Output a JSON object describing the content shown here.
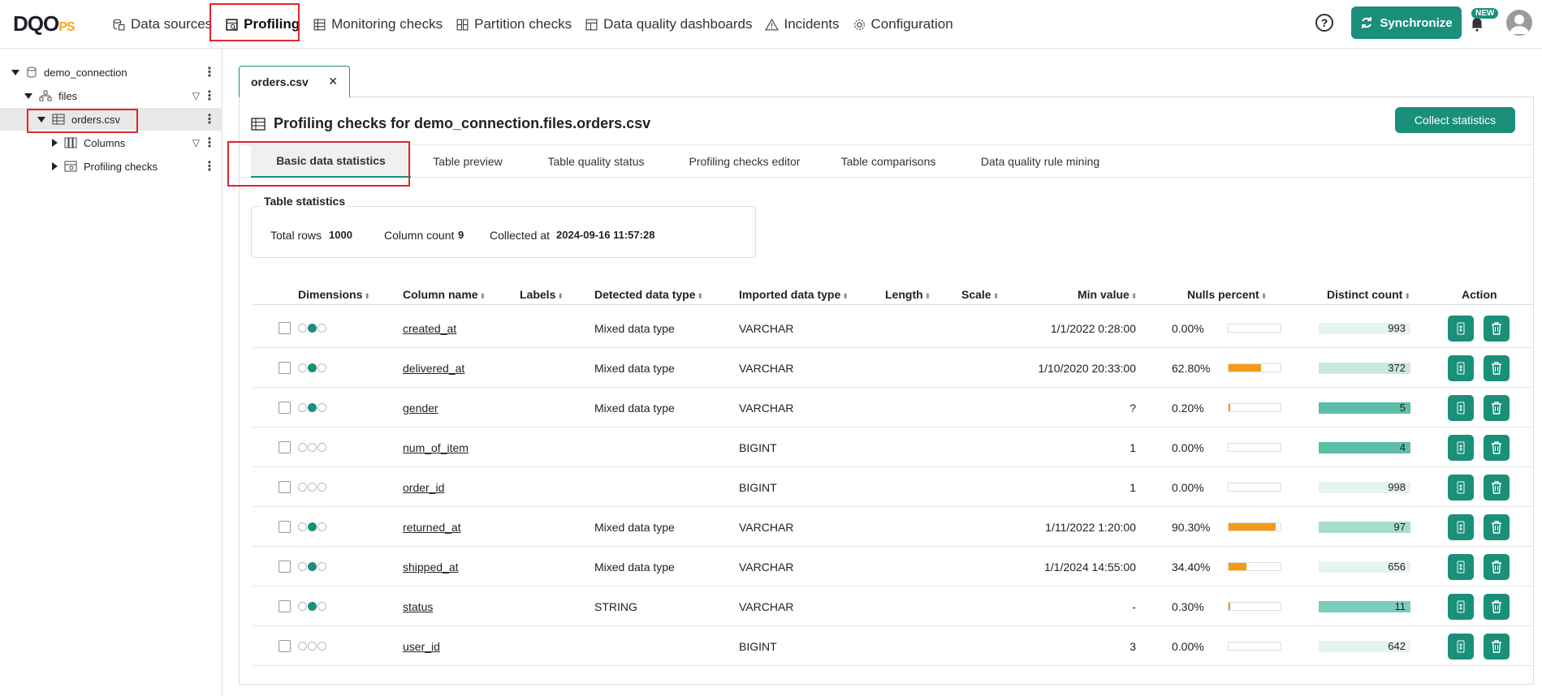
{
  "app": {
    "logo": "DQO",
    "logo_suffix": "PS"
  },
  "nav": [
    {
      "label": "Data sources",
      "icon": "database-icon"
    },
    {
      "label": "Profiling",
      "icon": "profiling-icon",
      "active": true
    },
    {
      "label": "Monitoring checks",
      "icon": "monitoring-icon"
    },
    {
      "label": "Partition checks",
      "icon": "partition-icon"
    },
    {
      "label": "Data quality dashboards",
      "icon": "dashboard-icon"
    },
    {
      "label": "Incidents",
      "icon": "warning-icon"
    },
    {
      "label": "Configuration",
      "icon": "gear-icon"
    }
  ],
  "header": {
    "help": "?",
    "sync_label": "Synchronize",
    "new_badge": "NEW"
  },
  "tree": [
    {
      "label": "demo_connection",
      "icon": "database-icon"
    },
    {
      "label": "files",
      "icon": "schema-icon"
    },
    {
      "label": "orders.csv",
      "icon": "table-icon",
      "selected": true
    },
    {
      "label": "Columns",
      "icon": "columns-icon"
    },
    {
      "label": "Profiling checks",
      "icon": "checks-icon"
    }
  ],
  "file_tab": {
    "label": "orders.csv",
    "close": "✕"
  },
  "panel": {
    "title": "Profiling checks for demo_connection.files.orders.csv",
    "collect_label": "Collect statistics"
  },
  "tabs": [
    {
      "label": "Basic data statistics",
      "active": true
    },
    {
      "label": "Table preview"
    },
    {
      "label": "Table quality status"
    },
    {
      "label": "Profiling checks editor"
    },
    {
      "label": "Table comparisons"
    },
    {
      "label": "Data quality rule mining"
    }
  ],
  "table_stats": {
    "legend": "Table statistics",
    "total_rows_label": "Total rows",
    "total_rows": "1000",
    "column_count_label": "Column count",
    "column_count": "9",
    "collected_at_label": "Collected at",
    "collected_at": "2024-09-16 11:57:28"
  },
  "columns_header": [
    "Dimensions",
    "Column name",
    "Labels",
    "Detected data type",
    "Imported data type",
    "Length",
    "Scale",
    "Min value",
    "Nulls percent",
    "Distinct count",
    "Action"
  ],
  "rows": [
    {
      "dims": [
        0,
        1,
        0
      ],
      "name": "created_at",
      "detected": "Mixed data type",
      "imported": "VARCHAR",
      "min": "1/1/2022 0:28:00",
      "nulls": "0.00%",
      "nulls_fraction": 0.0,
      "distinct": "993",
      "distinct_fraction": 0.0,
      "distinct_color": "#e6f4f1"
    },
    {
      "dims": [
        0,
        1,
        0
      ],
      "name": "delivered_at",
      "detected": "Mixed data type",
      "imported": "VARCHAR",
      "min": "1/10/2020 20:33:00",
      "nulls": "62.80%",
      "nulls_fraction": 0.628,
      "distinct": "372",
      "distinct_fraction": 1.0,
      "distinct_color": "#c8e9e2"
    },
    {
      "dims": [
        0,
        1,
        0
      ],
      "name": "gender",
      "detected": "Mixed data type",
      "imported": "VARCHAR",
      "min": "?",
      "nulls": "0.20%",
      "nulls_fraction": 0.02,
      "distinct": "5",
      "distinct_fraction": 1.0,
      "distinct_color": "#5dbfa9"
    },
    {
      "dims": [
        0,
        0,
        0
      ],
      "name": "num_of_item",
      "detected": "",
      "imported": "BIGINT",
      "min": "1",
      "nulls": "0.00%",
      "nulls_fraction": 0.0,
      "distinct": "4",
      "distinct_fraction": 1.0,
      "distinct_color": "#5dbfa9"
    },
    {
      "dims": [
        0,
        0,
        0
      ],
      "name": "order_id",
      "detected": "",
      "imported": "BIGINT",
      "min": "1",
      "nulls": "0.00%",
      "nulls_fraction": 0.0,
      "distinct": "998",
      "distinct_fraction": 0.0,
      "distinct_color": "#e6f4f1"
    },
    {
      "dims": [
        0,
        1,
        0
      ],
      "name": "returned_at",
      "detected": "Mixed data type",
      "imported": "VARCHAR",
      "min": "1/11/2022 1:20:00",
      "nulls": "90.30%",
      "nulls_fraction": 0.903,
      "distinct": "97",
      "distinct_fraction": 1.0,
      "distinct_color": "#a8dcd0"
    },
    {
      "dims": [
        0,
        1,
        0
      ],
      "name": "shipped_at",
      "detected": "Mixed data type",
      "imported": "VARCHAR",
      "min": "1/1/2024 14:55:00",
      "nulls": "34.40%",
      "nulls_fraction": 0.344,
      "distinct": "656",
      "distinct_fraction": 0.0,
      "distinct_color": "#e6f4f1"
    },
    {
      "dims": [
        0,
        1,
        0
      ],
      "name": "status",
      "detected": "STRING",
      "imported": "VARCHAR",
      "min": "-",
      "nulls": "0.30%",
      "nulls_fraction": 0.03,
      "distinct": "11",
      "distinct_fraction": 1.0,
      "distinct_color": "#7ccdbb"
    },
    {
      "dims": [
        0,
        0,
        0
      ],
      "name": "user_id",
      "detected": "",
      "imported": "BIGINT",
      "min": "3",
      "nulls": "0.00%",
      "nulls_fraction": 0.0,
      "distinct": "642",
      "distinct_fraction": 0.0,
      "distinct_color": "#e6f4f1"
    }
  ],
  "colors": {
    "accent": "#1a8f7a",
    "nulls_bar": "#f39c12",
    "highlight": "#e0262c"
  }
}
